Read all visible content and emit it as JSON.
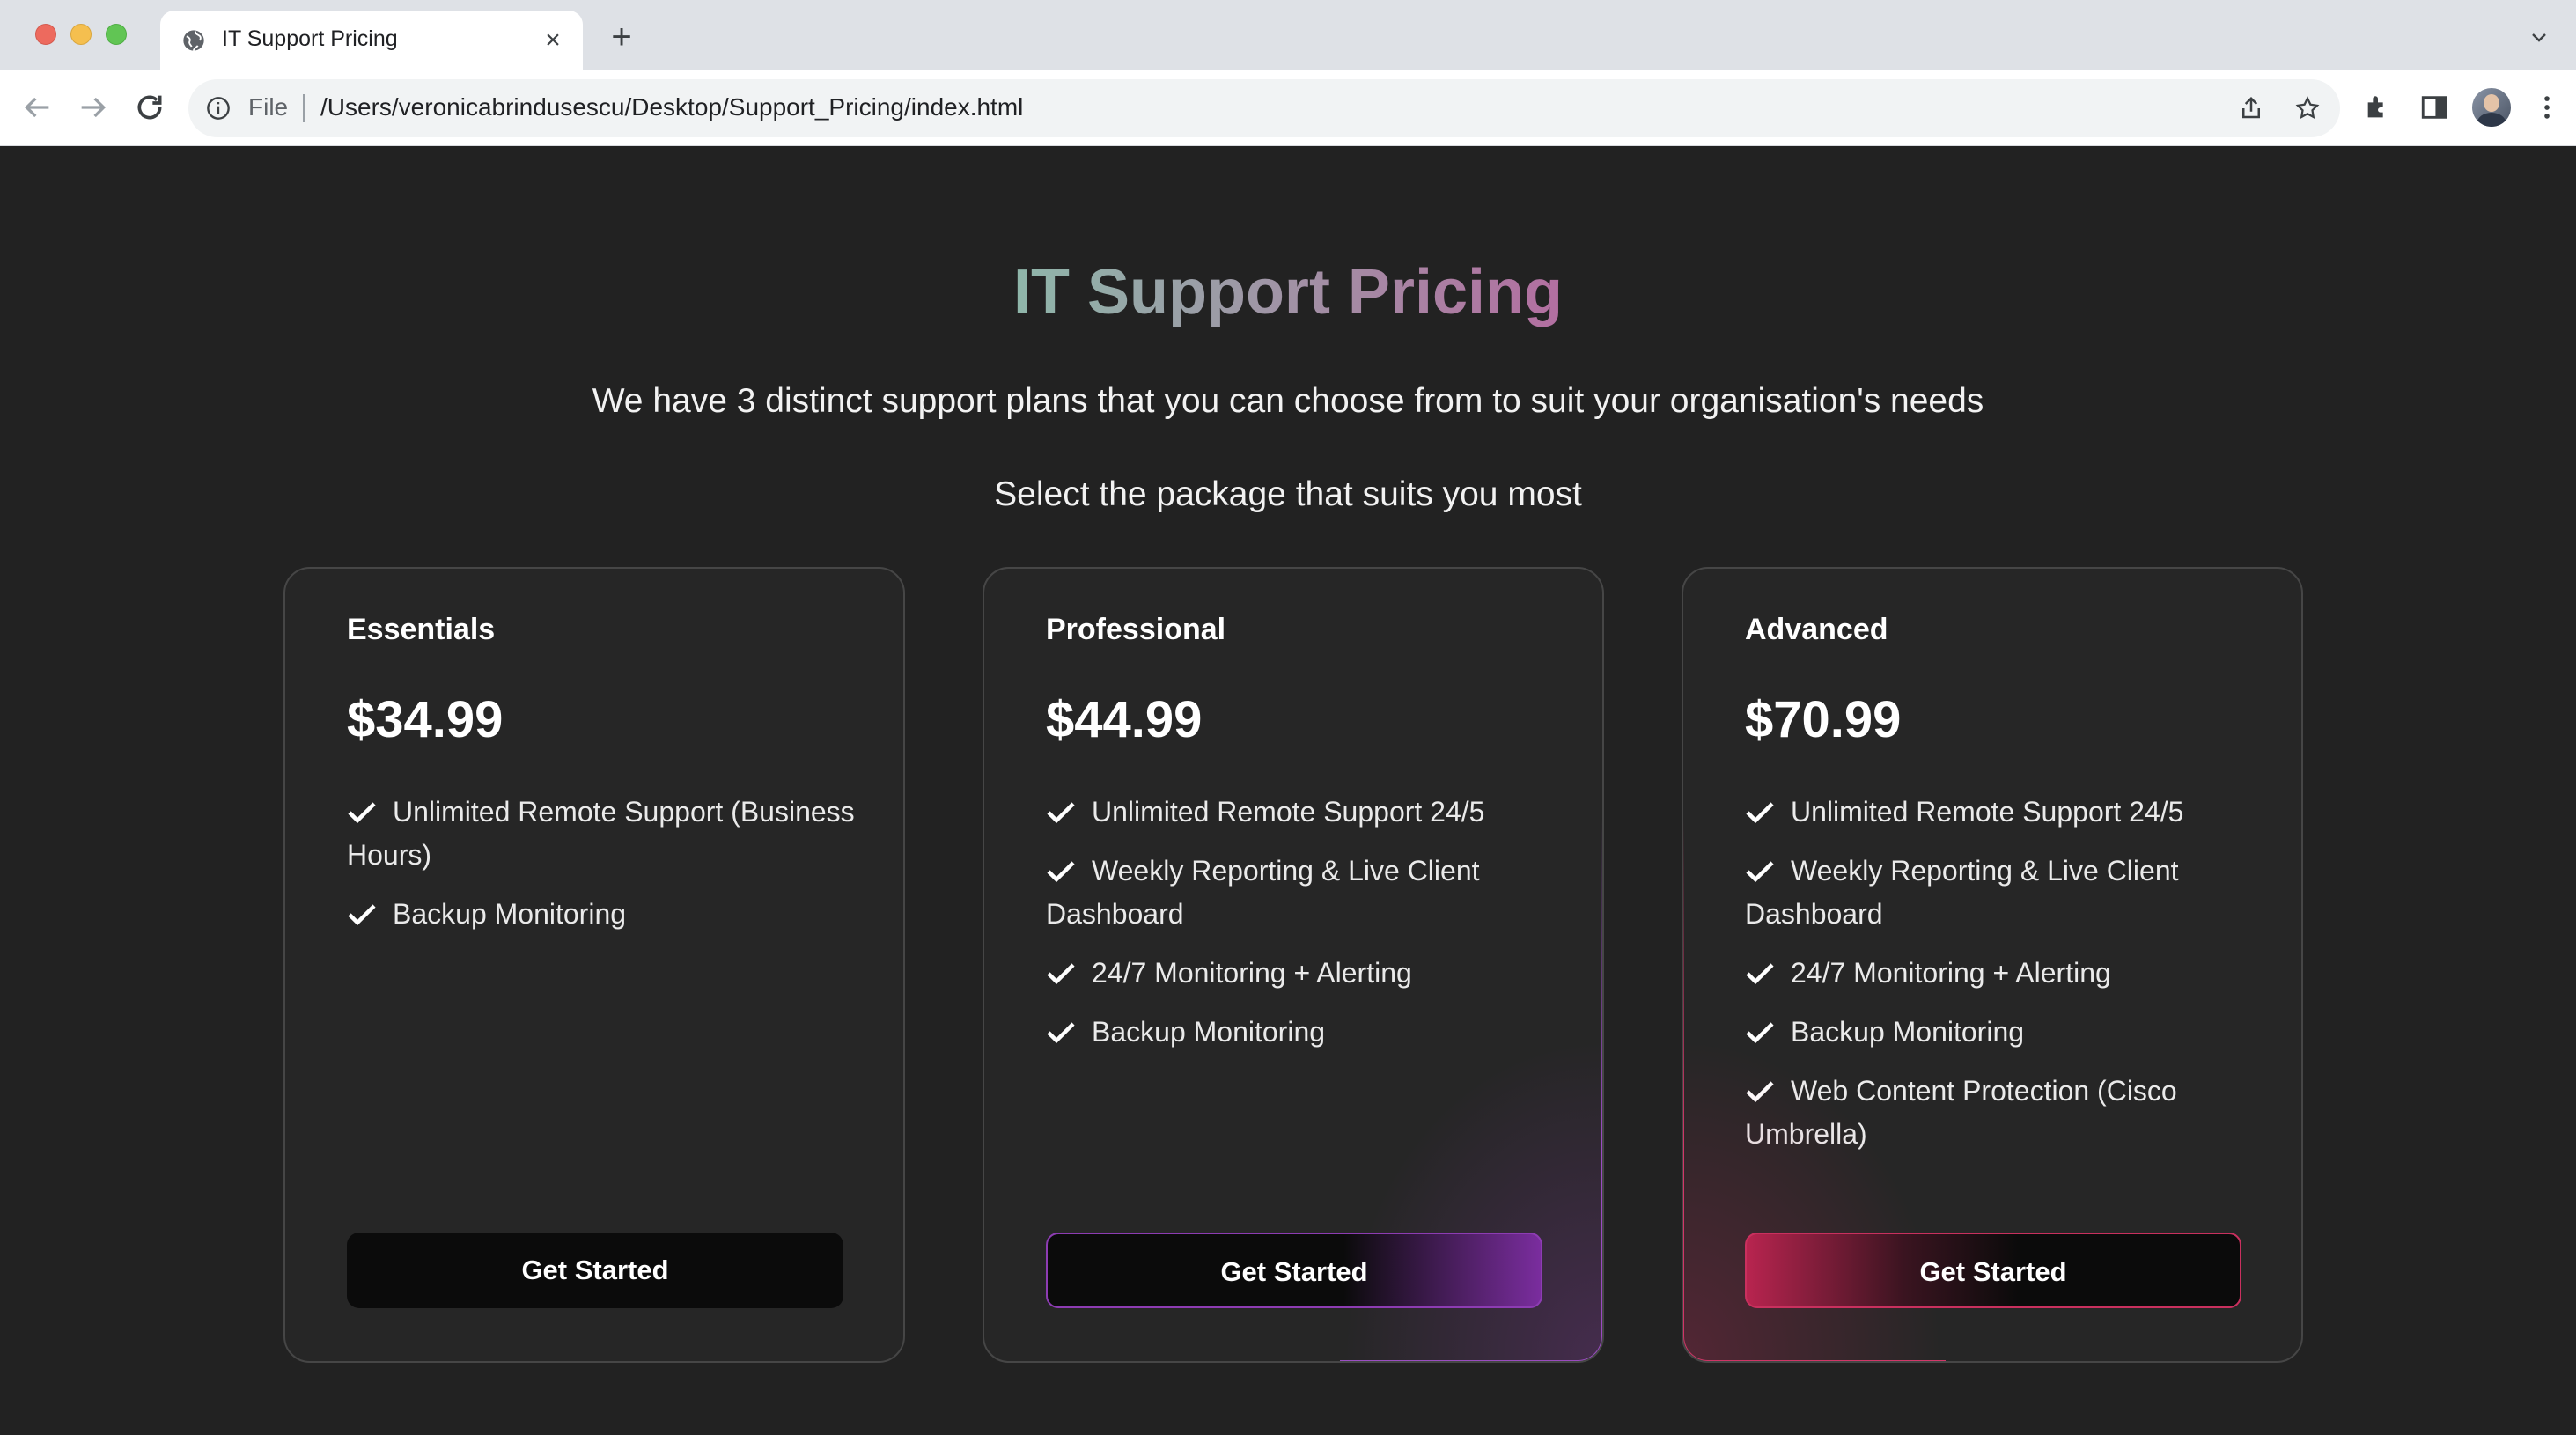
{
  "browser": {
    "tab_title": "IT Support Pricing",
    "new_tab_label": "+",
    "close_label": "×",
    "file_label": "File",
    "url": "/Users/veronicabrindusescu/Desktop/Support_Pricing/index.html"
  },
  "header": {
    "title": "IT Support Pricing",
    "subtitle": "We have 3 distinct support plans that you can choose from to suit your organisation's needs",
    "prompt": "Select the package that suits you most"
  },
  "plans": [
    {
      "name": "Essentials",
      "price": "$34.99",
      "features": [
        "Unlimited Remote Support (Business Hours)",
        "Backup Monitoring"
      ],
      "button": "Get Started"
    },
    {
      "name": "Professional",
      "price": "$44.99",
      "features": [
        "Unlimited Remote Support 24/5",
        "Weekly Reporting & Live Client Dashboard",
        "24/7 Monitoring + Alerting",
        "Backup Monitoring"
      ],
      "button": "Get Started",
      "accent": "#9b4fc4"
    },
    {
      "name": "Advanced",
      "price": "$70.99",
      "features": [
        "Unlimited Remote Support 24/5",
        "Weekly Reporting & Live Client Dashboard",
        "24/7 Monitoring + Alerting",
        "Backup Monitoring",
        "Web Content Protection (Cisco Umbrella)"
      ],
      "button": "Get Started",
      "accent": "#d3386a"
    }
  ],
  "colors": {
    "background": "#222222",
    "card": "#262626",
    "title_gradient": [
      "#4fe3b0",
      "#ef2f6b"
    ]
  }
}
